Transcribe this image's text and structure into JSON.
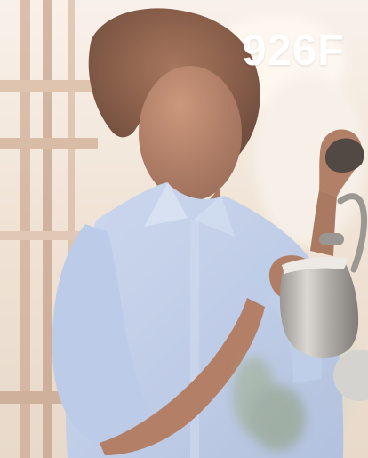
{
  "image": {
    "product_code": "926F",
    "subject": "woman-in-light-blue-shirt-steaming-milk-pitcher",
    "colors": {
      "shirt": "#b7c7e6",
      "skin": "#a66e55",
      "hair": "#7b4b36",
      "background_warm": "#efe2d4",
      "metal": "#c8c6c4",
      "wood": "#b88c72"
    }
  }
}
